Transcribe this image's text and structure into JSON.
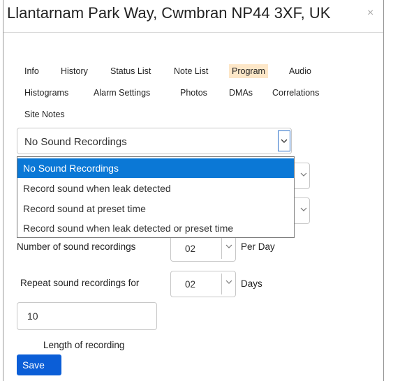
{
  "dialog": {
    "title": "Llantarnam Park Way, Cwmbran NP44 3XF, UK",
    "close_symbol": "×"
  },
  "tabs": {
    "row1": [
      "Info",
      "History",
      "Status List",
      "Note List",
      "Program",
      "Audio"
    ],
    "row2": [
      "Histograms",
      "Alarm Settings",
      "Photos",
      "DMAs",
      "Correlations"
    ],
    "row3": [
      "Site Notes"
    ],
    "active": "Program"
  },
  "sound_mode_select": {
    "value": "No Sound Recordings",
    "expanded": true,
    "options": [
      "No Sound Recordings",
      "Record sound when leak detected",
      "Record sound at preset time",
      "Record sound when leak detected or preset time"
    ],
    "selected_index": 0
  },
  "form": {
    "recordings_count_label": "Number of sound recordings",
    "recordings_count_value": "02",
    "recordings_count_unit": "Per Day",
    "repeat_label": "Repeat sound recordings for",
    "repeat_value": "02",
    "repeat_unit": "Days",
    "length_value": "10",
    "length_label": "Length of recording",
    "save_label": "Save"
  },
  "colors": {
    "active_tab_bg": "#fde7c8",
    "selected_option_bg": "#0b78d6",
    "save_button_bg": "#0b5ed7"
  }
}
